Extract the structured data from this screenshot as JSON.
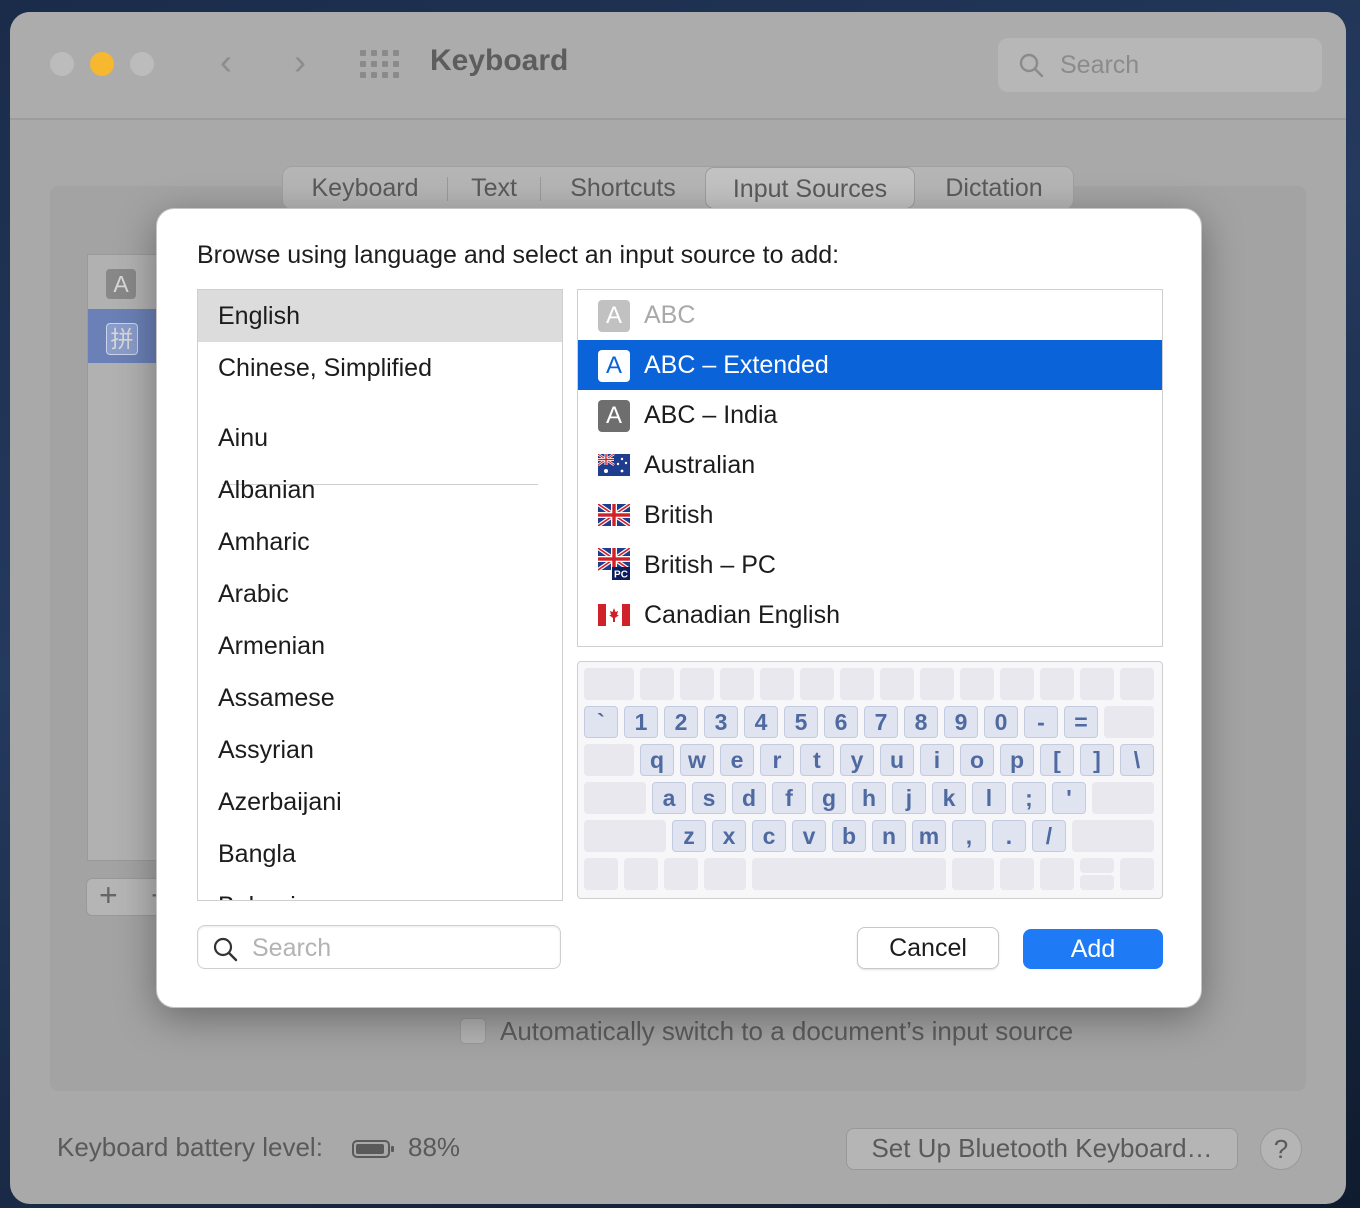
{
  "window": {
    "title": "Keyboard",
    "search_placeholder": "Search"
  },
  "tabs": [
    "Keyboard",
    "Text",
    "Shortcuts",
    "Input Sources",
    "Dictation"
  ],
  "active_tab": "Input Sources",
  "background": {
    "source_icons": [
      "A",
      "拼"
    ],
    "auto_switch_label": "Automatically switch to a document’s input source",
    "battery_label": "Keyboard battery level:",
    "battery_percent": "88%",
    "bluetooth_button": "Set Up Bluetooth Keyboard…",
    "help_button": "?",
    "add_symbol": "+",
    "remove_symbol": "−"
  },
  "modal": {
    "prompt": "Browse using language and select an input source to add:",
    "languages_top": [
      "English",
      "Chinese, Simplified"
    ],
    "languages": [
      "Ainu",
      "Albanian",
      "Amharic",
      "Arabic",
      "Armenian",
      "Assamese",
      "Assyrian",
      "Azerbaijani",
      "Bangla",
      "Bulgarian"
    ],
    "selected_language": "English",
    "sources": [
      {
        "label": "ABC",
        "icon": "A",
        "kind": "letter",
        "state": "dim"
      },
      {
        "label": "ABC – Extended",
        "icon": "A",
        "kind": "letter",
        "state": "selected"
      },
      {
        "label": "ABC – India",
        "icon": "A",
        "kind": "letter",
        "state": "normal"
      },
      {
        "label": "Australian",
        "icon": "australia-flag-icon",
        "kind": "flag",
        "state": "normal"
      },
      {
        "label": "British",
        "icon": "uk-flag-icon",
        "kind": "flag",
        "state": "normal"
      },
      {
        "label": "British – PC",
        "icon": "uk-pc-flag-icon",
        "kind": "flag",
        "state": "normal"
      },
      {
        "label": "Canadian English",
        "icon": "canada-flag-icon",
        "kind": "flag",
        "state": "normal"
      }
    ],
    "keyboard_rows": [
      [
        "`",
        "1",
        "2",
        "3",
        "4",
        "5",
        "6",
        "7",
        "8",
        "9",
        "0",
        "-",
        "="
      ],
      [
        "q",
        "w",
        "e",
        "r",
        "t",
        "y",
        "u",
        "i",
        "o",
        "p",
        "[",
        "]",
        "\\"
      ],
      [
        "a",
        "s",
        "d",
        "f",
        "g",
        "h",
        "j",
        "k",
        "l",
        ";",
        "'"
      ],
      [
        "z",
        "x",
        "c",
        "v",
        "b",
        "n",
        "m",
        ",",
        ".",
        "/"
      ]
    ],
    "search_placeholder": "Search",
    "cancel_label": "Cancel",
    "add_label": "Add"
  },
  "colors": {
    "accent": "#1f7bf5",
    "selection": "#0a63d8",
    "key_text": "#4f6aa0"
  }
}
